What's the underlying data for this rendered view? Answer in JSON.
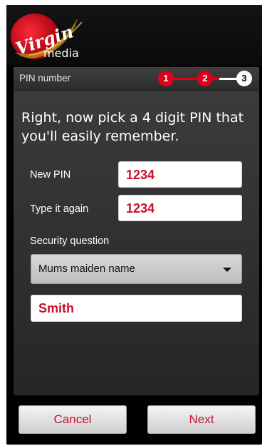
{
  "brand": {
    "logo_text": "Virgin",
    "logo_subtext": "media",
    "accent_color": "#e0001b"
  },
  "panel": {
    "title": "PIN number",
    "steps": [
      "1",
      "2",
      "3"
    ],
    "current_step": 3
  },
  "prompt": "Right, now pick a 4 digit PIN that you'll easily remember.",
  "form": {
    "new_pin": {
      "label": "New PIN",
      "value": "1234"
    },
    "confirm_pin": {
      "label": "Type it again",
      "value": "1234"
    },
    "security_question": {
      "label": "Security question",
      "selected": "Mums maiden name",
      "answer": "Smith"
    }
  },
  "buttons": {
    "cancel": "Cancel",
    "next": "Next"
  }
}
